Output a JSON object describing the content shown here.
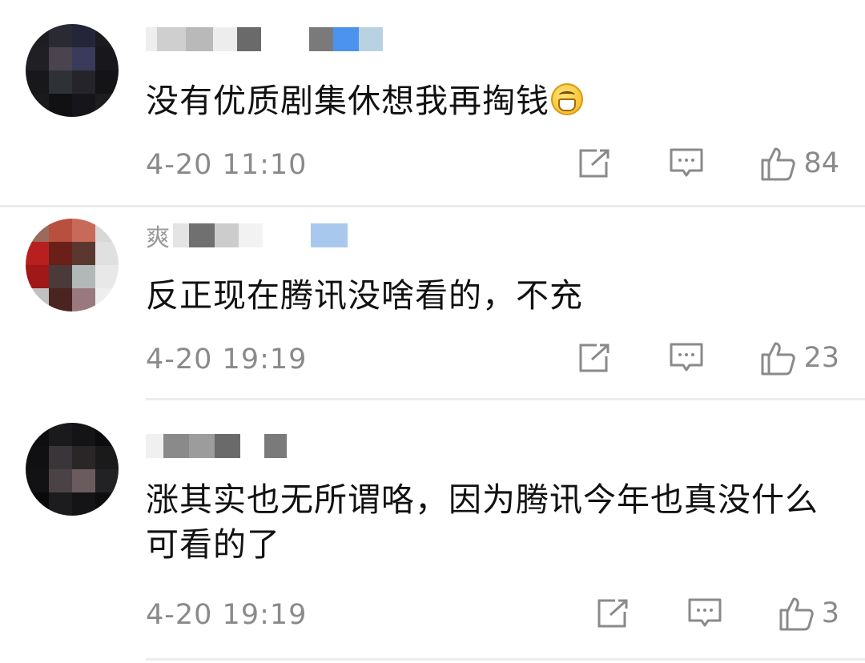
{
  "comments": [
    {
      "username_hint": "",
      "text": "没有优质剧集休想我再掏钱",
      "emoji": "grinning-emoji",
      "time": "4-20 11:10",
      "likes": "84"
    },
    {
      "username_hint": "爽",
      "text": "反正现在腾讯没啥看的，不充",
      "time": "4-20 19:19",
      "likes": "23"
    },
    {
      "username_hint": "",
      "text": "涨其实也无所谓咯，因为腾讯今年也真没什么可看的了",
      "time": "4-20 19:19",
      "likes": "3"
    }
  ],
  "icons": {
    "share": "share-icon",
    "reply": "comment-icon",
    "like": "thumbs-up-icon"
  },
  "colors": {
    "text": "#111111",
    "meta": "#8a8a8a",
    "divider": "#ececec"
  }
}
